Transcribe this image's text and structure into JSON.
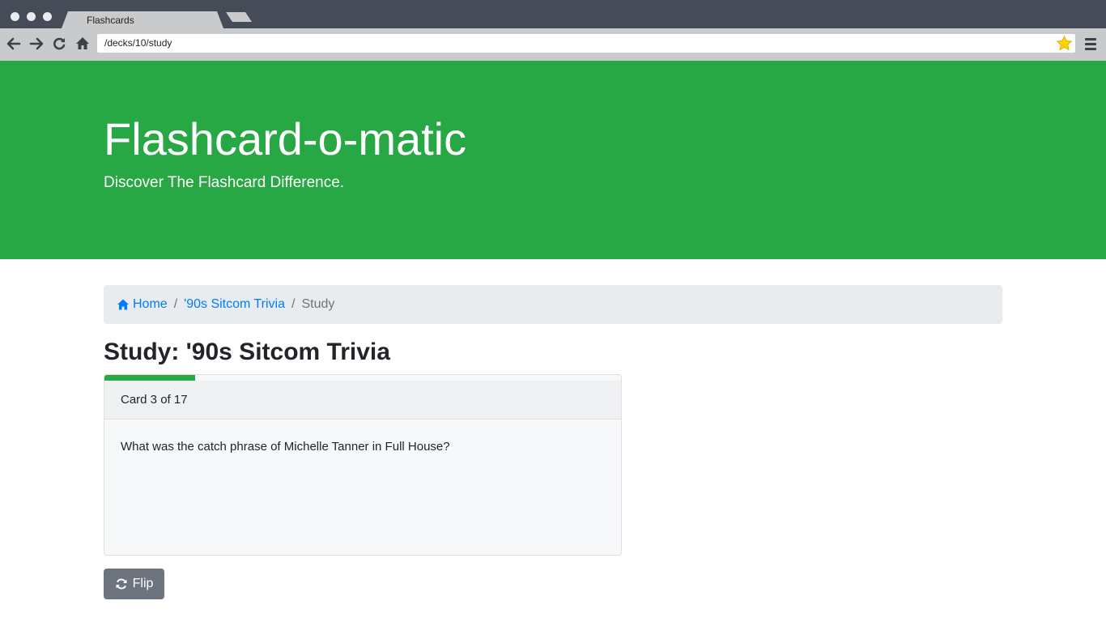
{
  "browser": {
    "tab_title": "Flashcards",
    "url": "/decks/10/study"
  },
  "jumbotron": {
    "title": "Flashcard-o-matic",
    "subtitle": "Discover The Flashcard Difference."
  },
  "breadcrumb": {
    "home_label": "Home",
    "deck_label": "'90s Sitcom Trivia",
    "current_label": "Study",
    "separator": "/"
  },
  "page": {
    "title": "Study: '90s Sitcom Trivia"
  },
  "card": {
    "header": "Card 3 of 17",
    "front_text": "What was the catch phrase of Michelle Tanner in Full House?",
    "progress_fraction": 0.176
  },
  "actions": {
    "flip_label": "Flip"
  },
  "colors": {
    "brand": "#28a745",
    "link": "#007bff",
    "secondary": "#6c757d",
    "star": "#ffd400"
  },
  "icons": {
    "home": "home-icon",
    "flip": "flip-icon",
    "star": "star-icon"
  }
}
